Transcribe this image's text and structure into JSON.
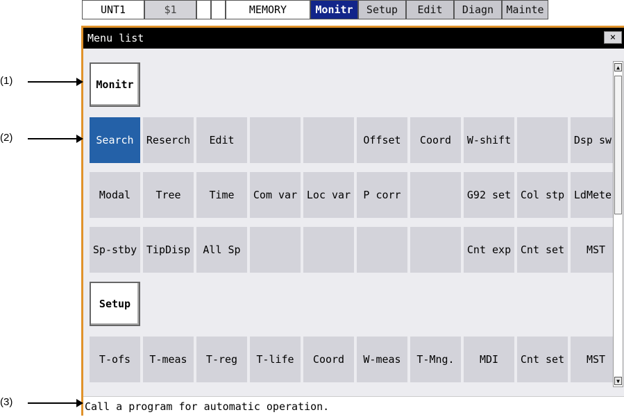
{
  "top_tabs": [
    {
      "label": "UNT1",
      "style": "plain"
    },
    {
      "label": "$1",
      "style": "gray"
    },
    {
      "label": "",
      "style": "plain"
    },
    {
      "label": "",
      "style": "plain"
    },
    {
      "label": "MEMORY",
      "style": "plain"
    },
    {
      "label": "Monitr",
      "style": "active"
    },
    {
      "label": "Setup",
      "style": "dim"
    },
    {
      "label": "Edit",
      "style": "dim"
    },
    {
      "label": "Diagn",
      "style": "dim"
    },
    {
      "label": "Mainte",
      "style": "dim"
    }
  ],
  "window": {
    "title": "Menu list",
    "close_label": "×",
    "status_text": "Call a program for automatic operation."
  },
  "sections": [
    {
      "label": "Monitr",
      "rows": [
        [
          "Search",
          "Reserch",
          "Edit",
          "",
          "",
          "Offset",
          "Coord",
          "W-shift",
          "",
          "Dsp sw."
        ],
        [
          "Modal",
          "Tree",
          "Time",
          "Com var",
          "Loc var",
          "P corr",
          "",
          "G92 set",
          "Col stp",
          "LdMeter"
        ],
        [
          "Sp-stby",
          "TipDisp",
          "All Sp",
          "",
          "",
          "",
          "",
          "Cnt exp",
          "Cnt set",
          "MST"
        ]
      ]
    },
    {
      "label": "Setup",
      "rows": [
        [
          "T-ofs",
          "T-meas",
          "T-reg",
          "T-life",
          "Coord",
          "W-meas",
          "T-Mng.",
          "MDI",
          "Cnt set",
          "MST"
        ]
      ]
    }
  ],
  "selected_item": "Search",
  "scrollbar": {
    "up_glyph": "▲",
    "down_glyph": "▼"
  },
  "callouts": [
    "(1)",
    "(2)",
    "(3)"
  ],
  "colors": {
    "accent": "#12258a",
    "selected": "#2461a8",
    "frame": "#e0922b"
  }
}
